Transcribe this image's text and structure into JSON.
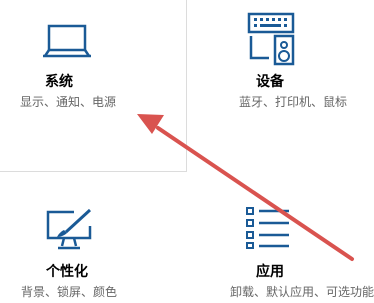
{
  "tiles": {
    "system": {
      "title": "系统",
      "description": "显示、通知、电源",
      "icon": "laptop-icon"
    },
    "devices": {
      "title": "设备",
      "description": "蓝牙、打印机、鼠标",
      "icon": "keyboard-speaker-icon"
    },
    "personalization": {
      "title": "个性化",
      "description": "背景、锁屏、颜色",
      "icon": "monitor-brush-icon"
    },
    "apps": {
      "title": "应用",
      "description": "卸载、默认应用、可选功能",
      "icon": "app-list-icon"
    }
  },
  "colors": {
    "icon": "#1a5a96",
    "title": "#000000",
    "description": "#666666",
    "annotation_arrow": "#d9534f",
    "divider": "#dcdcdc"
  }
}
